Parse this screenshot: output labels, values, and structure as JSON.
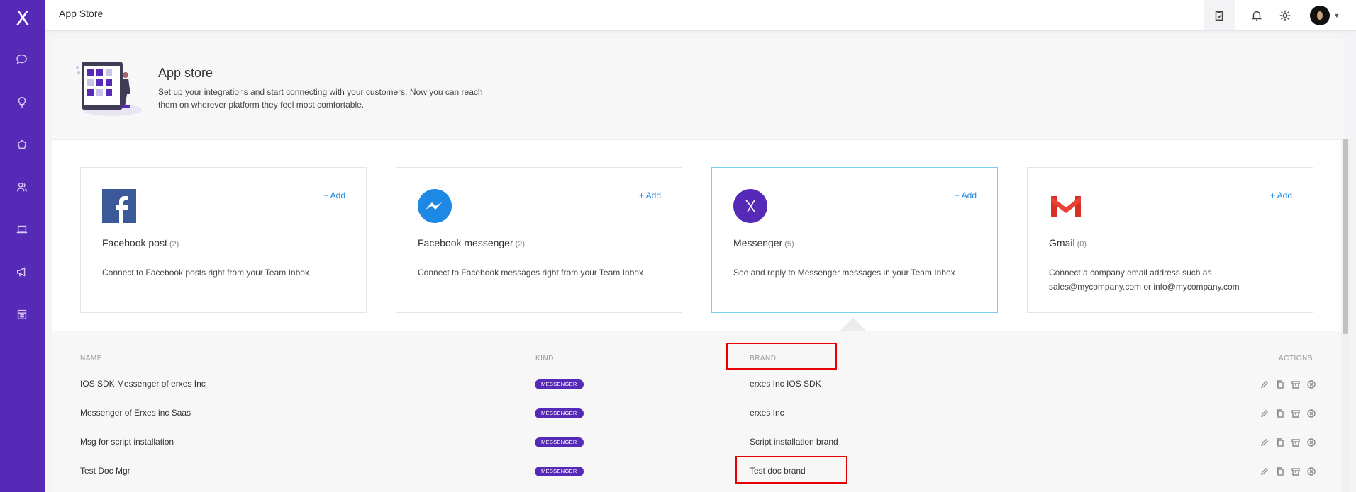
{
  "app": {
    "logo_glyph": "X"
  },
  "sidebar": {
    "items": [
      {
        "name": "conversations-icon"
      },
      {
        "name": "bulb-icon"
      },
      {
        "name": "box-icon"
      },
      {
        "name": "contacts-icon"
      },
      {
        "name": "laptop-icon"
      },
      {
        "name": "megaphone-icon"
      },
      {
        "name": "calendar-icon"
      }
    ]
  },
  "topbar": {
    "title": "App Store"
  },
  "hero": {
    "title": "App store",
    "description": "Set up your integrations and start connecting with your customers. Now you can reach them on wherever platform they feel most comfortable."
  },
  "cards": [
    {
      "name": "Facebook post",
      "count": "(2)",
      "add": "+ Add",
      "description": "Connect to Facebook posts right from your Team Inbox",
      "icon": "facebook-icon",
      "color": "#3b5998"
    },
    {
      "name": "Facebook messenger",
      "count": "(2)",
      "add": "+ Add",
      "description": "Connect to Facebook messages right from your Team Inbox",
      "icon": "messenger-icon",
      "color": "#1e88e5"
    },
    {
      "name": "Messenger",
      "count": "(5)",
      "add": "+ Add",
      "description": "See and reply to Messenger messages in your Team Inbox",
      "icon": "erxes-messenger-icon",
      "color": "#5629b6"
    },
    {
      "name": "Gmail",
      "count": "(0)",
      "add": "+ Add",
      "description": "Connect a company email address such as sales@mycompany.com or info@mycompany.com",
      "icon": "gmail-icon",
      "color": "#ea4335"
    }
  ],
  "table": {
    "headers": {
      "name": "NAME",
      "kind": "KIND",
      "brand": "BRAND",
      "actions": "ACTIONS"
    },
    "rows": [
      {
        "name": "IOS SDK Messenger of erxes Inc",
        "kind": "MESSENGER",
        "brand": "erxes Inc IOS SDK"
      },
      {
        "name": "Messenger of Erxes inc Saas",
        "kind": "MESSENGER",
        "brand": "erxes Inc"
      },
      {
        "name": "Msg for script installation",
        "kind": "MESSENGER",
        "brand": "Script installation brand"
      },
      {
        "name": "Test Doc Mgr",
        "kind": "MESSENGER",
        "brand": "Test doc brand"
      }
    ]
  },
  "colors": {
    "sidebar": "#5629b6",
    "accent": "#1e88e5",
    "highlight": "#e60000"
  }
}
